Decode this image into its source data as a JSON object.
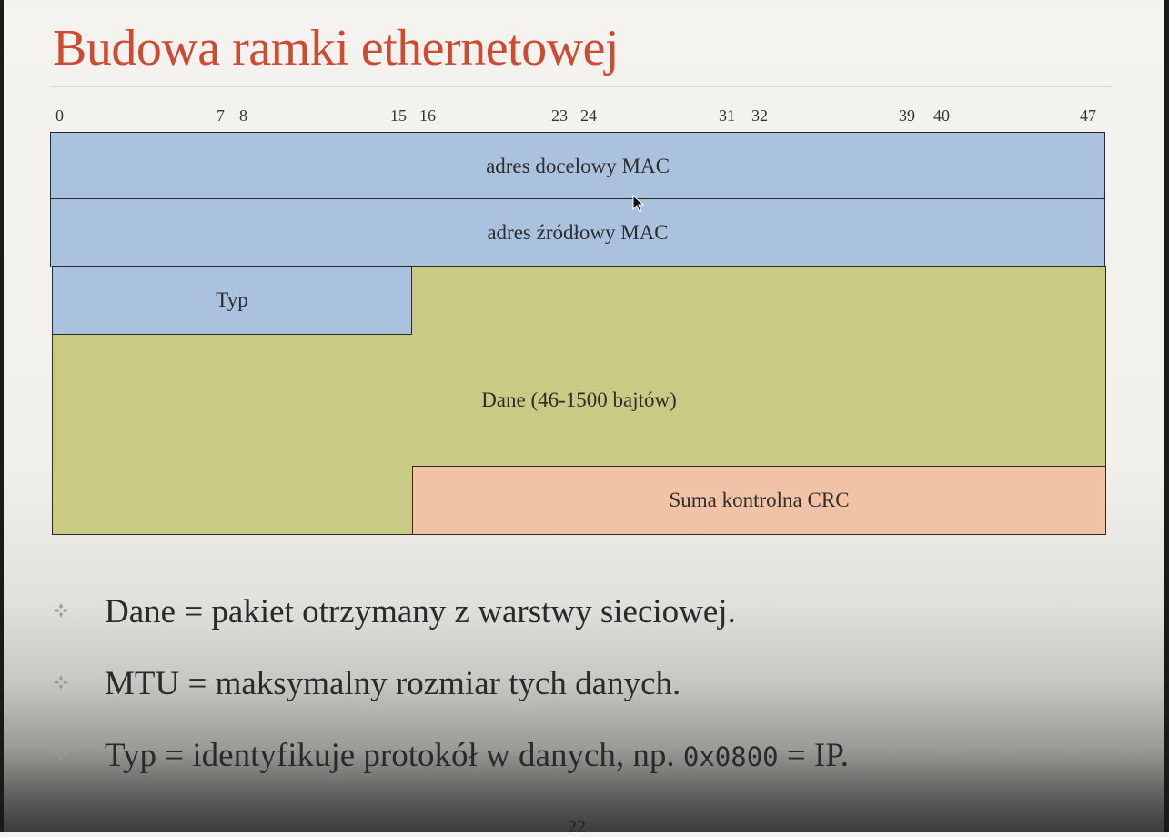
{
  "title": "Budowa ramki ethernetowej",
  "bit_labels": [
    "0",
    "7",
    "8",
    "15",
    "16",
    "23",
    "24",
    "31",
    "32",
    "39",
    "40",
    "47"
  ],
  "fields": {
    "dst_mac": "adres docelowy MAC",
    "src_mac": "adres źródłowy MAC",
    "type": "Typ",
    "data": "Dane (46-1500 bajtów)",
    "crc": "Suma kontrolna CRC"
  },
  "bullets": [
    {
      "text": "Dane = pakiet otrzymany z warstwy sieciowej."
    },
    {
      "text": "MTU = maksymalny rozmiar tych danych."
    },
    {
      "before": "Typ = identyfikuje protokół w danych, np. ",
      "code": "0x0800",
      "after": " = IP."
    }
  ],
  "page_number": "22",
  "colors": {
    "title": "#cc4b33",
    "header_field": "#abc2df",
    "data_field": "#c9cb85",
    "crc_field": "#f1c2a6"
  }
}
